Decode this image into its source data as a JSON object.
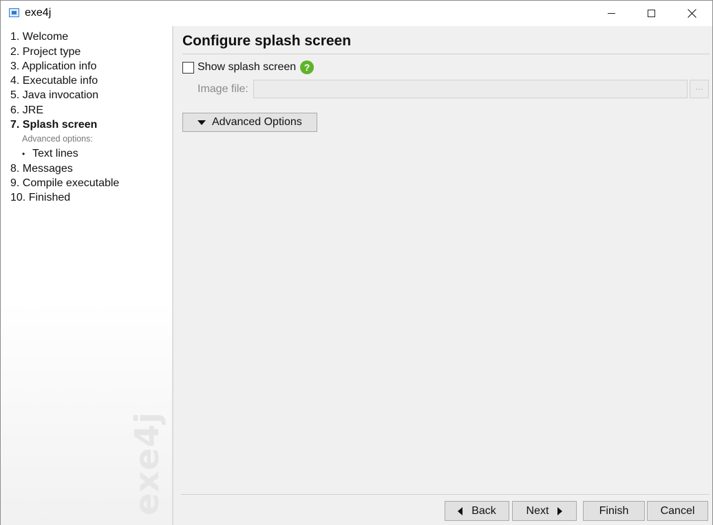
{
  "window": {
    "title": "exe4j",
    "icon": "exe4j-app-icon"
  },
  "sidebar": {
    "steps": [
      {
        "label": "1. Welcome"
      },
      {
        "label": "2. Project type"
      },
      {
        "label": "3. Application info"
      },
      {
        "label": "4. Executable info"
      },
      {
        "label": "5. Java invocation"
      },
      {
        "label": "6. JRE"
      },
      {
        "label": "7. Splash screen",
        "active": true
      },
      {
        "label": "8. Messages"
      },
      {
        "label": "9. Compile executable"
      },
      {
        "label": "10. Finished"
      }
    ],
    "advanced_caption": "Advanced options:",
    "advanced_items": [
      {
        "bullet": "•",
        "label": "Text lines"
      }
    ],
    "watermark": "exe4j"
  },
  "main": {
    "title": "Configure splash screen",
    "show_splash": {
      "label": "Show splash screen",
      "checked": false
    },
    "help_icon": "?",
    "image_file": {
      "label": "Image file:",
      "value": "",
      "browse_label": "···"
    },
    "advanced_button": "Advanced Options"
  },
  "footer": {
    "back": "Back",
    "next": "Next",
    "finish": "Finish",
    "cancel": "Cancel"
  },
  "colors": {
    "help_icon": "#5fb32a",
    "accent": "#2e7bd6"
  }
}
